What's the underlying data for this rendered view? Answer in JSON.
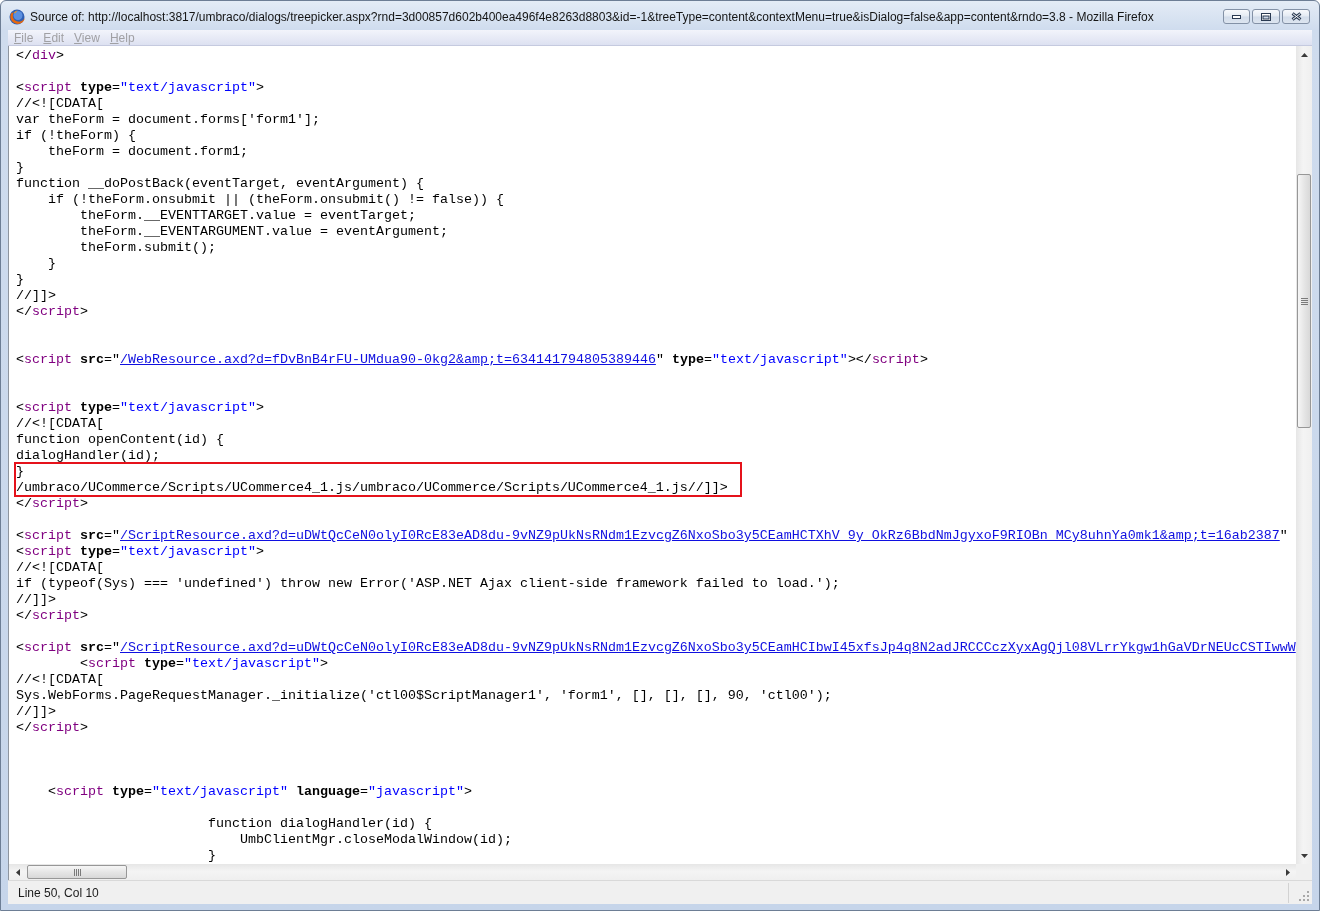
{
  "window": {
    "title": "Source of: http://localhost:3817/umbraco/dialogs/treepicker.aspx?rnd=3d00857d602b400ea496f4e8263d8803&id=-1&treeType=content&contextMenu=true&isDialog=false&app=content&rndo=3.8 - Mozilla Firefox"
  },
  "menu": [
    {
      "label": "File",
      "disabled": true
    },
    {
      "label": "Edit",
      "disabled": true
    },
    {
      "label": "View",
      "disabled": true
    },
    {
      "label": "Help",
      "disabled": true
    }
  ],
  "source_lines": [
    {
      "kind": "code",
      "highlighted": false,
      "segments": [
        {
          "kind": "plain",
          "text": "</"
        },
        {
          "kind": "tag",
          "text": "div"
        },
        {
          "kind": "plain",
          "text": ">"
        }
      ]
    },
    {
      "kind": "blank"
    },
    {
      "kind": "code",
      "highlighted": false,
      "segments": [
        {
          "kind": "plain",
          "text": "<"
        },
        {
          "kind": "tag",
          "text": "script"
        },
        {
          "kind": "attr",
          "text": " type"
        },
        {
          "kind": "plain",
          "text": "="
        },
        {
          "kind": "value",
          "text": "\"text/javascript\""
        },
        {
          "kind": "plain",
          "text": ">"
        }
      ]
    },
    {
      "kind": "code",
      "highlighted": false,
      "segments": [
        {
          "kind": "plain",
          "text": "//<![CDATA["
        }
      ]
    },
    {
      "kind": "code",
      "highlighted": false,
      "segments": [
        {
          "kind": "plain",
          "text": "var theForm = document.forms['form1'];"
        }
      ]
    },
    {
      "kind": "code",
      "highlighted": false,
      "segments": [
        {
          "kind": "plain",
          "text": "if (!theForm) {"
        }
      ]
    },
    {
      "kind": "code",
      "highlighted": false,
      "segments": [
        {
          "kind": "plain",
          "text": "    theForm = document.form1;"
        }
      ]
    },
    {
      "kind": "code",
      "highlighted": false,
      "segments": [
        {
          "kind": "plain",
          "text": "}"
        }
      ]
    },
    {
      "kind": "code",
      "highlighted": false,
      "segments": [
        {
          "kind": "plain",
          "text": "function __doPostBack(eventTarget, eventArgument) {"
        }
      ]
    },
    {
      "kind": "code",
      "highlighted": false,
      "segments": [
        {
          "kind": "plain",
          "text": "    if (!theForm.onsubmit || (theForm.onsubmit() != false)) {"
        }
      ]
    },
    {
      "kind": "code",
      "highlighted": false,
      "segments": [
        {
          "kind": "plain",
          "text": "        theForm.__EVENTTARGET.value = eventTarget;"
        }
      ]
    },
    {
      "kind": "code",
      "highlighted": false,
      "segments": [
        {
          "kind": "plain",
          "text": "        theForm.__EVENTARGUMENT.value = eventArgument;"
        }
      ]
    },
    {
      "kind": "code",
      "highlighted": false,
      "segments": [
        {
          "kind": "plain",
          "text": "        theForm.submit();"
        }
      ]
    },
    {
      "kind": "code",
      "highlighted": false,
      "segments": [
        {
          "kind": "plain",
          "text": "    }"
        }
      ]
    },
    {
      "kind": "code",
      "highlighted": false,
      "segments": [
        {
          "kind": "plain",
          "text": "}"
        }
      ]
    },
    {
      "kind": "code",
      "highlighted": false,
      "segments": [
        {
          "kind": "plain",
          "text": "//]]>"
        }
      ]
    },
    {
      "kind": "code",
      "highlighted": false,
      "segments": [
        {
          "kind": "plain",
          "text": "</"
        },
        {
          "kind": "tag",
          "text": "script"
        },
        {
          "kind": "plain",
          "text": ">"
        }
      ]
    },
    {
      "kind": "blank"
    },
    {
      "kind": "blank"
    },
    {
      "kind": "code",
      "highlighted": false,
      "segments": [
        {
          "kind": "plain",
          "text": "<"
        },
        {
          "kind": "tag",
          "text": "script"
        },
        {
          "kind": "attr",
          "text": " src"
        },
        {
          "kind": "plain",
          "text": "=\""
        },
        {
          "kind": "link",
          "text": "/WebResource.axd?d=fDvBnB4rFU-UMdua90-0kg2&amp;t=634141794805389446"
        },
        {
          "kind": "plain",
          "text": "\""
        },
        {
          "kind": "attr",
          "text": " type"
        },
        {
          "kind": "plain",
          "text": "="
        },
        {
          "kind": "value",
          "text": "\"text/javascript\""
        },
        {
          "kind": "plain",
          "text": "></"
        },
        {
          "kind": "tag",
          "text": "script"
        },
        {
          "kind": "plain",
          "text": ">"
        }
      ]
    },
    {
      "kind": "blank"
    },
    {
      "kind": "blank"
    },
    {
      "kind": "code",
      "highlighted": false,
      "segments": [
        {
          "kind": "plain",
          "text": "<"
        },
        {
          "kind": "tag",
          "text": "script"
        },
        {
          "kind": "attr",
          "text": " type"
        },
        {
          "kind": "plain",
          "text": "="
        },
        {
          "kind": "value",
          "text": "\"text/javascript\""
        },
        {
          "kind": "plain",
          "text": ">"
        }
      ]
    },
    {
      "kind": "code",
      "highlighted": false,
      "segments": [
        {
          "kind": "plain",
          "text": "//<![CDATA["
        }
      ]
    },
    {
      "kind": "code",
      "highlighted": false,
      "segments": [
        {
          "kind": "plain",
          "text": "function openContent(id) {"
        }
      ]
    },
    {
      "kind": "code",
      "highlighted": false,
      "segments": [
        {
          "kind": "plain",
          "text": "dialogHandler(id);"
        }
      ]
    },
    {
      "kind": "code",
      "highlighted": true,
      "segments": [
        {
          "kind": "plain",
          "text": "}"
        }
      ]
    },
    {
      "kind": "code",
      "highlighted": true,
      "segments": [
        {
          "kind": "plain",
          "text": "/umbraco/UCommerce/Scripts/UCommerce4_1.js/umbraco/UCommerce/Scripts/UCommerce4_1.js//]]>"
        }
      ]
    },
    {
      "kind": "code",
      "highlighted": false,
      "segments": [
        {
          "kind": "plain",
          "text": "</"
        },
        {
          "kind": "tag",
          "text": "script"
        },
        {
          "kind": "plain",
          "text": ">"
        }
      ]
    },
    {
      "kind": "blank"
    },
    {
      "kind": "code",
      "highlighted": false,
      "segments": [
        {
          "kind": "plain",
          "text": "<"
        },
        {
          "kind": "tag",
          "text": "script"
        },
        {
          "kind": "attr",
          "text": " src"
        },
        {
          "kind": "plain",
          "text": "=\""
        },
        {
          "kind": "link",
          "text": "/ScriptResource.axd?d=uDWtQcCeN0olyI0RcE83eAD8du-9vNZ9pUkNsRNdm1EzvcgZ6NxoSbo3y5CEamHCTXhV_9y_OkRz6BbdNmJgyxoF9RIOBn_MCy8uhnYa0mk1&amp;t=16ab2387"
        },
        {
          "kind": "plain",
          "text": "\""
        }
      ]
    },
    {
      "kind": "code",
      "highlighted": false,
      "segments": [
        {
          "kind": "plain",
          "text": "<"
        },
        {
          "kind": "tag",
          "text": "script"
        },
        {
          "kind": "attr",
          "text": " type"
        },
        {
          "kind": "plain",
          "text": "="
        },
        {
          "kind": "value",
          "text": "\"text/javascript\""
        },
        {
          "kind": "plain",
          "text": ">"
        }
      ]
    },
    {
      "kind": "code",
      "highlighted": false,
      "segments": [
        {
          "kind": "plain",
          "text": "//<![CDATA["
        }
      ]
    },
    {
      "kind": "code",
      "highlighted": false,
      "segments": [
        {
          "kind": "plain",
          "text": "if (typeof(Sys) === 'undefined') throw new Error('ASP.NET Ajax client-side framework failed to load.');"
        }
      ]
    },
    {
      "kind": "code",
      "highlighted": false,
      "segments": [
        {
          "kind": "plain",
          "text": "//]]>"
        }
      ]
    },
    {
      "kind": "code",
      "highlighted": false,
      "segments": [
        {
          "kind": "plain",
          "text": "</"
        },
        {
          "kind": "tag",
          "text": "script"
        },
        {
          "kind": "plain",
          "text": ">"
        }
      ]
    },
    {
      "kind": "blank"
    },
    {
      "kind": "code",
      "highlighted": false,
      "segments": [
        {
          "kind": "plain",
          "text": "<"
        },
        {
          "kind": "tag",
          "text": "script"
        },
        {
          "kind": "attr",
          "text": " src"
        },
        {
          "kind": "plain",
          "text": "=\""
        },
        {
          "kind": "link",
          "text": "/ScriptResource.axd?d=uDWtQcCeN0olyI0RcE83eAD8du-9vNZ9pUkNsRNdm1EzvcgZ6NxoSbo3y5CEamHCIbwI45xfsJp4q8N2adJRCCCczXyxAgQjl08VLrrYkgw1hGaVDrNEUcCSTIwwW"
        }
      ]
    },
    {
      "kind": "code",
      "highlighted": false,
      "segments": [
        {
          "kind": "plain",
          "text": "        <"
        },
        {
          "kind": "tag",
          "text": "script"
        },
        {
          "kind": "attr",
          "text": " type"
        },
        {
          "kind": "plain",
          "text": "="
        },
        {
          "kind": "value",
          "text": "\"text/javascript\""
        },
        {
          "kind": "plain",
          "text": ">"
        }
      ]
    },
    {
      "kind": "code",
      "highlighted": false,
      "segments": [
        {
          "kind": "plain",
          "text": "//<![CDATA["
        }
      ]
    },
    {
      "kind": "code",
      "highlighted": false,
      "segments": [
        {
          "kind": "plain",
          "text": "Sys.WebForms.PageRequestManager._initialize('ctl00$ScriptManager1', 'form1', [], [], [], 90, 'ctl00');"
        }
      ]
    },
    {
      "kind": "code",
      "highlighted": false,
      "segments": [
        {
          "kind": "plain",
          "text": "//]]>"
        }
      ]
    },
    {
      "kind": "code",
      "highlighted": false,
      "segments": [
        {
          "kind": "plain",
          "text": "</"
        },
        {
          "kind": "tag",
          "text": "script"
        },
        {
          "kind": "plain",
          "text": ">"
        }
      ]
    },
    {
      "kind": "blank"
    },
    {
      "kind": "blank"
    },
    {
      "kind": "blank"
    },
    {
      "kind": "code",
      "highlighted": false,
      "segments": [
        {
          "kind": "plain",
          "text": "    <"
        },
        {
          "kind": "tag",
          "text": "script"
        },
        {
          "kind": "attr",
          "text": " type"
        },
        {
          "kind": "plain",
          "text": "="
        },
        {
          "kind": "value",
          "text": "\"text/javascript\""
        },
        {
          "kind": "attr",
          "text": " language"
        },
        {
          "kind": "plain",
          "text": "="
        },
        {
          "kind": "value",
          "text": "\"javascript\""
        },
        {
          "kind": "plain",
          "text": ">"
        }
      ]
    },
    {
      "kind": "blank"
    },
    {
      "kind": "code",
      "highlighted": false,
      "segments": [
        {
          "kind": "plain",
          "text": "                        function dialogHandler(id) {"
        }
      ]
    },
    {
      "kind": "code",
      "highlighted": false,
      "segments": [
        {
          "kind": "plain",
          "text": "                            UmbClientMgr.closeModalWindow(id);"
        }
      ]
    },
    {
      "kind": "code",
      "highlighted": false,
      "segments": [
        {
          "kind": "plain",
          "text": "                        }"
        }
      ]
    }
  ],
  "status_bar": {
    "text": "Line 50, Col 10"
  }
}
